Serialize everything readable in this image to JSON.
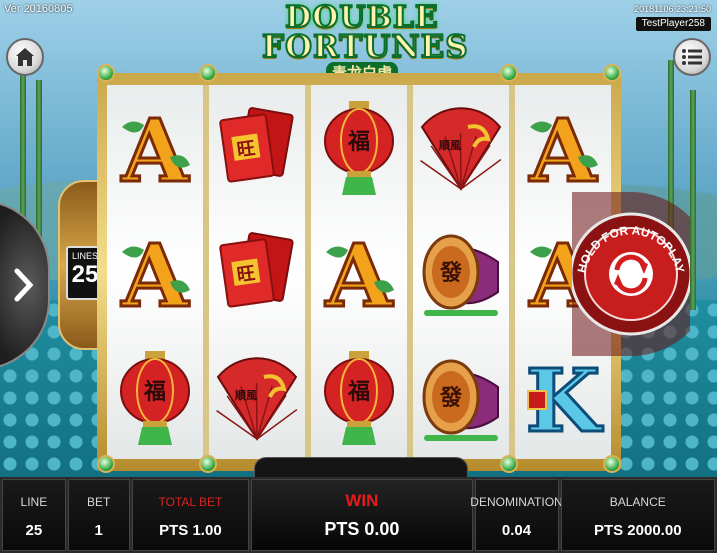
{
  "header": {
    "version": "Ver 20160805",
    "datetime": "20181106 23:21:50",
    "player": "TestPlayer258"
  },
  "logo": {
    "line1": "DOUBLE",
    "line2": "FORTUNES",
    "subtitle": "青龙白虎"
  },
  "lines": {
    "label": "LINES",
    "value": "25"
  },
  "autoplay": {
    "label": "HOLD FOR AUTOPLAY"
  },
  "reels": [
    [
      "A",
      "A",
      "lantern"
    ],
    [
      "red-envelope",
      "red-envelope",
      "fan"
    ],
    [
      "lantern",
      "A",
      "lantern"
    ],
    [
      "fan",
      "drum",
      "drum"
    ],
    [
      "A",
      "A",
      "K"
    ]
  ],
  "symbol_text": {
    "lantern": "福",
    "red-envelope": "旺",
    "fan": "順風",
    "drum": "發",
    "K": "K",
    "A": "A"
  },
  "bottom": {
    "line_label": "LINE",
    "line_value": "25",
    "bet_label": "BET",
    "bet_value": "1",
    "total_bet_label": "TOTAL BET",
    "total_bet_value": "PTS 1.00",
    "win_label": "WIN",
    "win_value": "PTS 0.00",
    "denomination_label": "DENOMINATION",
    "denomination_value": "0.04",
    "balance_label": "BALANCE",
    "balance_value": "PTS 2000.00"
  },
  "colors": {
    "accent_red": "#e51c1c",
    "frame_gold": "#d9b455",
    "gem_green": "#3cae4a"
  }
}
